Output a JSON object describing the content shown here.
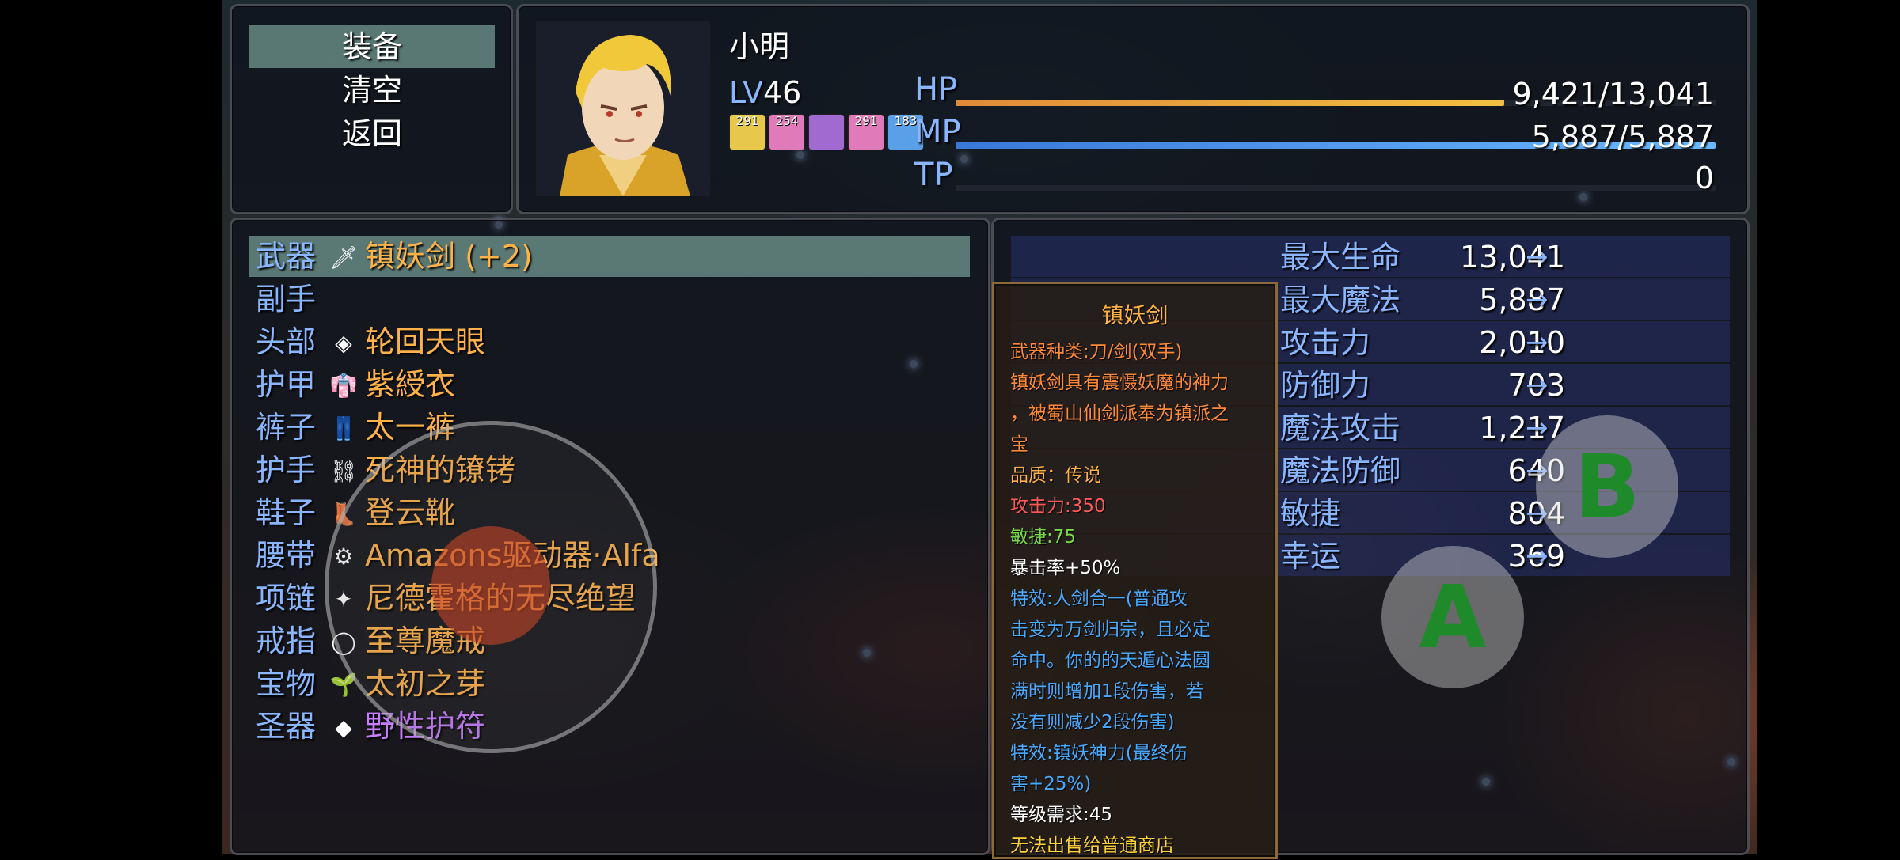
{
  "commands": [
    "装备",
    "清空",
    "返回"
  ],
  "actor": {
    "name": "小明",
    "level_label": "LV",
    "level": "46",
    "states": [
      {
        "icon": "fist-buff-icon",
        "count": "291",
        "color": "#e8c84a"
      },
      {
        "icon": "fist-pink-buff-icon",
        "count": "254",
        "color": "#e07ab8"
      },
      {
        "icon": "jaw-buff-icon",
        "count": "",
        "color": "#a06ad0"
      },
      {
        "icon": "hand-pink-buff-icon",
        "count": "291",
        "color": "#e07ab8"
      },
      {
        "icon": "wing-blue-buff-icon",
        "count": "183",
        "color": "#5aa0e8"
      }
    ],
    "hp": {
      "label": "HP",
      "value": "9,421/13,041",
      "ratio": 0.722,
      "color_a": "#e08a3a",
      "color_b": "#f0c040"
    },
    "mp": {
      "label": "MP",
      "value": "5,887/5,887",
      "ratio": 1.0,
      "color_a": "#3a78d8",
      "color_b": "#6ab8ff"
    },
    "tp": {
      "label": "TP",
      "value": "0",
      "ratio": 0.0,
      "color_a": "#3aa04a",
      "color_b": "#8ad84a"
    }
  },
  "slots": [
    {
      "slot": "武器",
      "icon": "sword-icon",
      "glyph": "🗡",
      "item": "镇妖剑 (+2)",
      "style": "orange"
    },
    {
      "slot": "副手",
      "icon": "",
      "glyph": "",
      "item": "",
      "style": "orange"
    },
    {
      "slot": "头部",
      "icon": "eye-gem-icon",
      "glyph": "◈",
      "item": "轮回天眼",
      "style": "orange"
    },
    {
      "slot": "护甲",
      "icon": "robe-icon",
      "glyph": "👘",
      "item": "紫綬衣",
      "style": "orange"
    },
    {
      "slot": "裤子",
      "icon": "pants-icon",
      "glyph": "👖",
      "item": "太一裤",
      "style": "orange"
    },
    {
      "slot": "护手",
      "icon": "shackles-icon",
      "glyph": "⛓",
      "item": "死神的镣铐",
      "style": "orange"
    },
    {
      "slot": "鞋子",
      "icon": "boot-icon",
      "glyph": "👢",
      "item": "登云靴",
      "style": "orange"
    },
    {
      "slot": "腰带",
      "icon": "belt-driver-icon",
      "glyph": "⚙",
      "item": "Amazons驱动器·Alfa",
      "style": "orange"
    },
    {
      "slot": "项链",
      "icon": "necklace-icon",
      "glyph": "✦",
      "item": "尼德霍格的无尽绝望",
      "style": "orange"
    },
    {
      "slot": "戒指",
      "icon": "ring-icon",
      "glyph": "◯",
      "item": "至尊魔戒",
      "style": "orange"
    },
    {
      "slot": "宝物",
      "icon": "sprout-icon",
      "glyph": "🌱",
      "item": "太初之芽",
      "style": "orange"
    },
    {
      "slot": "圣器",
      "icon": "amulet-icon",
      "glyph": "◆",
      "item": "野性护符",
      "style": "purple"
    }
  ],
  "stats": [
    {
      "name": "最大生命",
      "value": "13,041"
    },
    {
      "name": "最大魔法",
      "value": "5,887"
    },
    {
      "name": "攻击力",
      "value": "2,010"
    },
    {
      "name": "防御力",
      "value": "703"
    },
    {
      "name": "魔法攻击",
      "value": "1,217"
    },
    {
      "name": "魔法防御",
      "value": "640"
    },
    {
      "name": "敏捷",
      "value": "804"
    },
    {
      "name": "幸运",
      "value": "369"
    }
  ],
  "stat_arrow": "→",
  "tooltip": {
    "title": "镇妖剑",
    "lines": [
      {
        "text": "武器种类:刀/剑(双手)",
        "color": "#ff8a3a"
      },
      {
        "text": "镇妖剑具有震慑妖魔的神力",
        "color": "#ff8a3a"
      },
      {
        "text": "，被蜀山仙剑派奉为镇派之",
        "color": "#ff8a3a"
      },
      {
        "text": "宝",
        "color": "#ff8a3a"
      },
      {
        "text": "品质：传说",
        "color": "#ffb24a"
      },
      {
        "text": "攻击力:350",
        "color": "#ff5a5a"
      },
      {
        "text": "敏捷:75",
        "color": "#7ad84a"
      },
      {
        "text": "暴击率+50%",
        "color": "#ffffff"
      },
      {
        "text": "特效:人剑合一(普通攻",
        "color": "#4aa8ff"
      },
      {
        "text": "击变为万剑归宗，且必定",
        "color": "#4aa8ff"
      },
      {
        "text": "命中。你的的天遁心法圆",
        "color": "#4aa8ff"
      },
      {
        "text": "满时则增加1段伤害，若",
        "color": "#4aa8ff"
      },
      {
        "text": "没有则减少2段伤害)",
        "color": "#4aa8ff"
      },
      {
        "text": "特效:镇妖神力(最终伤",
        "color": "#4aa8ff"
      },
      {
        "text": "害+25%)",
        "color": "#4aa8ff"
      },
      {
        "text": "等级需求:45",
        "color": "#ffffff"
      },
      {
        "text": "无法出售给普通商店",
        "color": "#ffd23a"
      }
    ]
  },
  "controls": {
    "a_label": "A",
    "b_label": "B"
  }
}
